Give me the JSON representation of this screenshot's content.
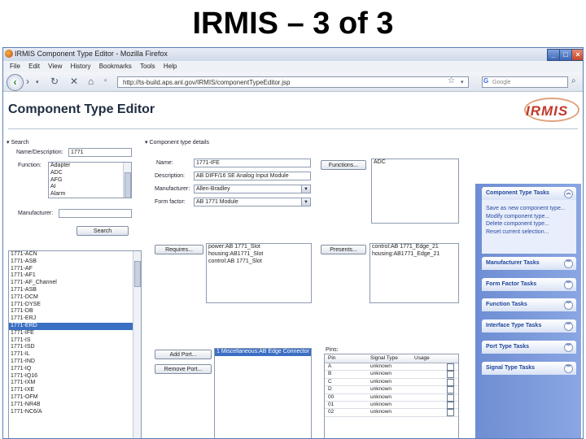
{
  "slide_title": "IRMIS – 3 of 3",
  "window": {
    "title": "IRMIS Component Type Editor - Mozilla Firefox",
    "menu": [
      "File",
      "Edit",
      "View",
      "History",
      "Bookmarks",
      "Tools",
      "Help"
    ],
    "url": "http://ts-build.aps.anl.gov/IRMIS/componentTypeEditor.jsp",
    "search_placeholder": "Google"
  },
  "app": {
    "title": "Component Type Editor",
    "logo_text": "IRMIS"
  },
  "search": {
    "section_label": "Search",
    "name_label": "Name/Description:",
    "name_value": "1771",
    "function_label": "Function:",
    "functions": [
      "Adapter",
      "ADC",
      "AFG",
      "AI",
      "Alarm"
    ],
    "manufacturer_label": "Manufacturer:",
    "manufacturer_value": "",
    "search_button": "Search"
  },
  "results": [
    "1771-ACN",
    "1771-ASB",
    "1771-AF",
    "1771-AF1",
    "1771-AF_Channel",
    "1771-ASB",
    "1771-DCM",
    "1771-DYSE",
    "1771-DB",
    "1771-ERJ",
    "1771-ERD",
    "1771-IFE",
    "1771-IS",
    "1771-ISD",
    "1771-IL",
    "1771-IND",
    "1771-IQ",
    "1771-IQ16",
    "1771-IXM",
    "1771-IXE",
    "1771-OFM",
    "1771-NR4B",
    "1771-NC6/A"
  ],
  "results_selected_index": 10,
  "details": {
    "section_label": "Component type details",
    "name_label": "Name:",
    "name_value": "1771-IFE",
    "description_label": "Description:",
    "description_value": "AB DIFF/16 SE Analog Input Module",
    "manufacturer_label": "Manufacturer:",
    "manufacturer_value": "Allen-Bradley",
    "form_factor_label": "Form factor:",
    "form_factor_value": "AB 1771 Module",
    "functions_button": "Functions...",
    "functions_list": [
      "ADC"
    ],
    "requires_button": "Requires...",
    "requires_list": [
      "power:AB 1771_Slot",
      "housing:AB1771_Slot",
      "control:AB 1771_Slot"
    ],
    "presents_button": "Presents...",
    "presents_list": [
      "control:AB 1771_Edge_21",
      "housing:AB1771_Edge_21"
    ],
    "add_port_button": "Add Port...",
    "remove_port_button": "Remove Port...",
    "ports_list": [
      "1 Miscellaneous:AB Edge Connector"
    ],
    "pins_label": "Pins:",
    "pins_columns": [
      "Pin",
      "Signal Type",
      "Usage"
    ],
    "pins": [
      {
        "pin": "A",
        "signal": "unknown",
        "usage": ""
      },
      {
        "pin": "B",
        "signal": "unknown",
        "usage": ""
      },
      {
        "pin": "C",
        "signal": "unknown",
        "usage": ""
      },
      {
        "pin": "D",
        "signal": "unknown",
        "usage": ""
      },
      {
        "pin": "00",
        "signal": "unknown",
        "usage": ""
      },
      {
        "pin": "01",
        "signal": "unknown",
        "usage": ""
      },
      {
        "pin": "02",
        "signal": "unknown",
        "usage": ""
      }
    ]
  },
  "tasks": {
    "component": {
      "title": "Component Type Tasks",
      "items": [
        "Save as new component type...",
        "Modify component type...",
        "Delete component type...",
        "Reset current selection..."
      ]
    },
    "others": [
      "Manufacturer Tasks",
      "Form Factor Tasks",
      "Function Tasks",
      "Interface Type Tasks",
      "Port Type Tasks",
      "Signal Type Tasks"
    ]
  }
}
